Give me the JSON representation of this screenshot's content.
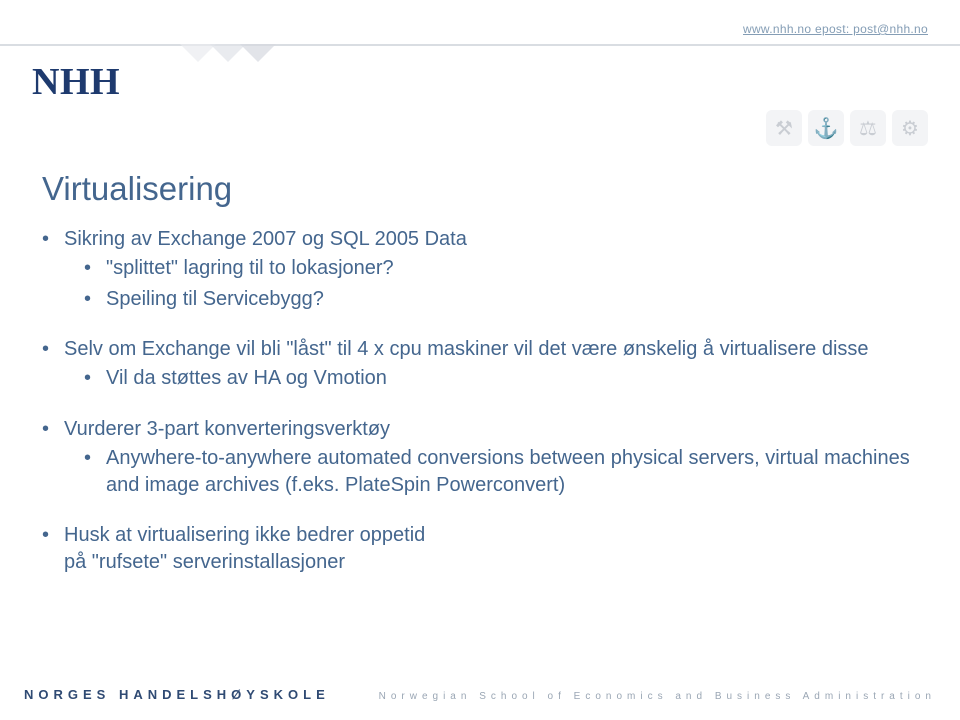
{
  "header": {
    "url": "www.nhh.no epost: post@nhh.no",
    "logo": "NHH"
  },
  "title": "Virtualisering",
  "bullets": [
    {
      "text": "Sikring av Exchange 2007 og  SQL 2005 Data",
      "sub": [
        {
          "text": "\"splittet\" lagring til to lokasjoner?"
        },
        {
          "text": "Speiling til Servicebygg?"
        }
      ]
    },
    {
      "text": "Selv om Exchange vil bli \"låst\" til 4 x cpu maskiner vil det være ønskelig å virtualisere disse",
      "sub": [
        {
          "text": "Vil da støttes av HA og Vmotion"
        }
      ]
    },
    {
      "text": "Vurderer 3-part konverteringsverktøy",
      "sub": [
        {
          "text": "Anywhere-to-anywhere automated conversions between physical servers, virtual machines and image archives (f.eks. PlateSpin Powerconvert)"
        }
      ]
    },
    {
      "text": "Husk at virtualisering ikke bedrer oppetid",
      "tail": "på \"rufsete\" serverinstallasjoner"
    }
  ],
  "footer": {
    "left": "NORGES HANDELSHØYSKOLE",
    "right": "Norwegian School of Economics and Business Administration"
  },
  "icons": {
    "i1": "⚒",
    "i2": "⚓",
    "i3": "⚖",
    "i4": "⚙"
  }
}
